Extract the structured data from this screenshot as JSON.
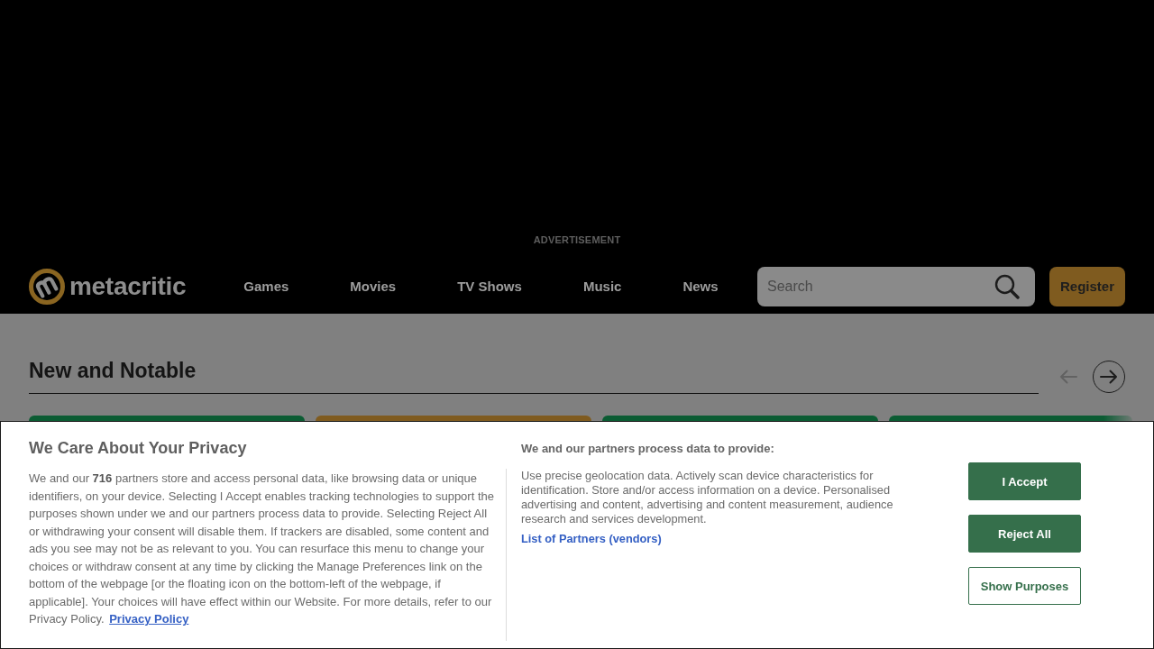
{
  "advertisement_label": "ADVERTISEMENT",
  "header": {
    "logo_text": "metacritic",
    "nav": [
      {
        "label": "Games"
      },
      {
        "label": "Movies"
      },
      {
        "label": "TV Shows"
      },
      {
        "label": "Music"
      },
      {
        "label": "News"
      }
    ],
    "search": {
      "placeholder": "Search"
    },
    "register_button": "Register"
  },
  "section": {
    "title": "New and Notable",
    "controls": [
      {
        "kind": "prev",
        "disabled": true
      },
      {
        "kind": "next",
        "disabled": false
      }
    ],
    "cards": [
      {
        "color": "#0b5c33"
      },
      {
        "color": "#7f5b1f"
      },
      {
        "color": "#0b5c33"
      },
      {
        "color": "#0b5c33"
      }
    ]
  },
  "consent": {
    "title": "We Care About Your Privacy",
    "body": "We and our **716** partners store and access personal data, like browsing data or unique identifiers, on your device. Selecting I Accept enables tracking technologies to support the purposes shown under we and our partners process data to provide. Selecting Reject All or withdrawing your consent will disable them. If trackers are disabled, some content and ads you see may not be as relevant to you. You can resurface this menu to change your choices or withdraw consent at any time by clicking the Manage Preferences link on the bottom of the webpage [or the floating icon on the bottom-left of the webpage, if applicable]. Your choices will have effect within our Website. For more details, refer to our Privacy Policy.",
    "privacy_link": "Privacy Policy",
    "purposes_heading": "We and our partners process data to provide:",
    "purposes_text": "Use precise geolocation data. Actively scan device characteristics for identification. Store and/or access information on a device. Personalised advertising and content, advertising and content measurement, audience research and services development.",
    "partners_link": "List of Partners (vendors)",
    "buttons": [
      {
        "label": "I Accept",
        "kind": "accept"
      },
      {
        "label": "Reject All",
        "kind": "reject"
      },
      {
        "label": "Show Purposes",
        "kind": "purposes"
      }
    ]
  }
}
